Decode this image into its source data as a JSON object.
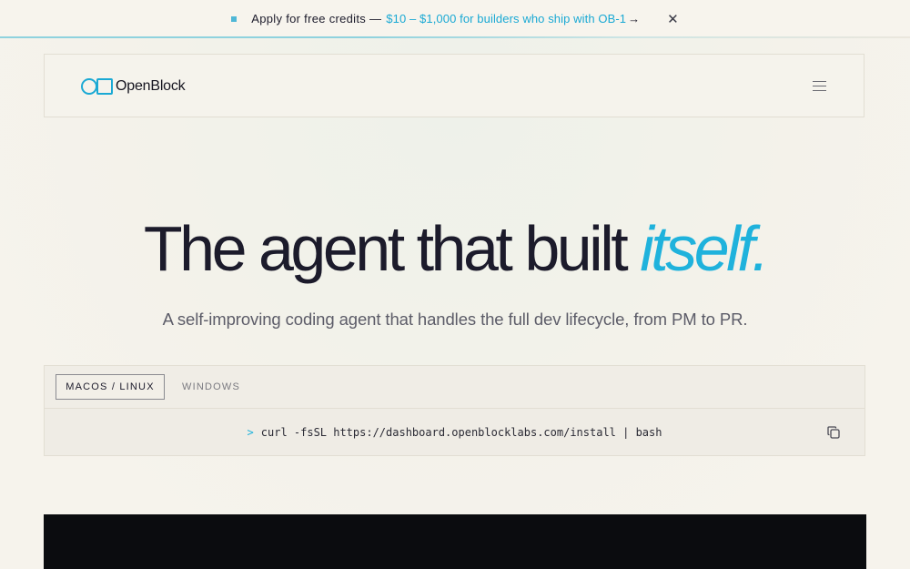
{
  "banner": {
    "text": "Apply for free credits —",
    "link": "$10 – $1,000 for builders who ship with OB-1",
    "arrow": "→",
    "close": "✕"
  },
  "nav": {
    "logo_text": "OpenBlock"
  },
  "hero": {
    "title_main": "The agent that built ",
    "title_accent": "itself.",
    "subtitle": "A self-improving coding agent that handles the full dev lifecycle, from PM to PR."
  },
  "install": {
    "tabs": [
      {
        "label": "MACOS / LINUX",
        "active": true
      },
      {
        "label": "WINDOWS",
        "active": false
      }
    ],
    "prompt": ">",
    "command": "curl -fsSL https://dashboard.openblocklabs.com/install | bash"
  },
  "colors": {
    "accent": "#1fb2dc",
    "text": "#1c1b2b",
    "background": "#f6f3ec",
    "dark": "#0b0c0f"
  }
}
